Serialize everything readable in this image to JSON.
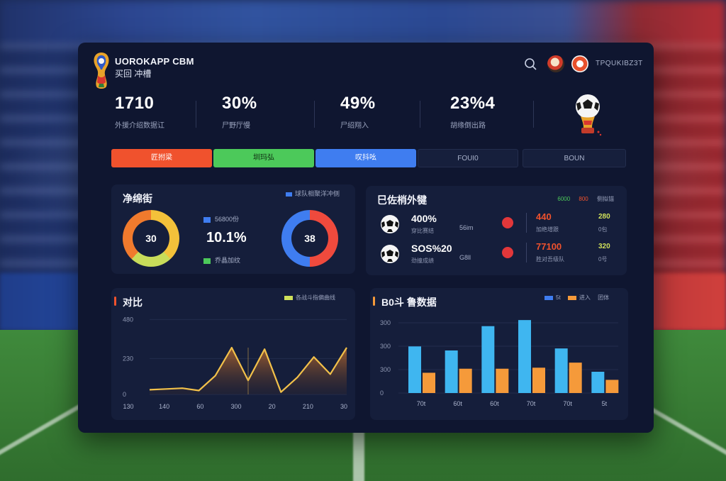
{
  "brand": {
    "title": "UOROKAPP CBM",
    "subtitle": "买回 冲槽",
    "user_label": "TPQUKIBZ3T"
  },
  "header_icons": [
    "search-icon",
    "player-avatar",
    "ball-avatar"
  ],
  "stats": [
    {
      "value": "1710",
      "label": "外援介绍数据讧"
    },
    {
      "value": "30%",
      "label": "尸野厅慢"
    },
    {
      "value": "49%",
      "label": "尸绍翔入"
    },
    {
      "value": "23%4",
      "label": "胡缘倒出路"
    }
  ],
  "tabs": [
    "匠拊梁",
    "圳玛弘",
    "叹抖吆",
    "FOUI0",
    "BOUN"
  ],
  "donut_panel": {
    "title": "净绵街",
    "legend": "球队相聚洋冲侧",
    "key_blue": "56800份",
    "key_green": "乔晶加纹",
    "center_value": "10.1%",
    "donut_left": "30",
    "donut_right": "38"
  },
  "list_panel": {
    "title": "巳佐梢外犍",
    "legend": [
      "6000",
      "800",
      "侧拟锚"
    ],
    "rows": [
      {
        "value": "400%",
        "sublabel": "穿比赛结",
        "stat": "56im",
        "odds": "440",
        "odds_label": "加绝增跟",
        "side": "280",
        "side_label": "0包"
      },
      {
        "value": "SOS%20",
        "sublabel": "劲撞成绩",
        "stat": "G8ll",
        "odds": "77100",
        "odds_label": "胜对吾级队",
        "side": "320",
        "side_label": "0号"
      }
    ]
  },
  "line_panel": {
    "title": "对比",
    "legend": "各战斗指偏曲线"
  },
  "bar_panel": {
    "title": "B0斗 鲁数据",
    "legend": [
      "5t",
      "进入",
      "团体"
    ]
  },
  "colors": {
    "accent_orange": "#f0522d",
    "accent_green": "#4cc95a",
    "accent_blue": "#3f7df0",
    "panel_bg": "#151e3b",
    "window_bg": "#0f1630",
    "bar_cyan": "#3fb6f0",
    "bar_orange": "#f59a3a",
    "line_gold": "#f2c14a"
  },
  "chart_data": [
    {
      "type": "area",
      "title": "对比",
      "x": [
        "130",
        "140",
        "60",
        "300",
        "20",
        "210",
        "30"
      ],
      "x_ticks": [
        "130",
        "140",
        "60",
        "300",
        "20",
        "210",
        "30"
      ],
      "y_ticks": [
        "0",
        "230",
        "480"
      ],
      "ylim": [
        0,
        500
      ],
      "series": [
        {
          "name": "各战斗指偏曲线",
          "values": [
            30,
            35,
            40,
            25,
            120,
            300,
            90,
            290,
            15,
            110,
            240,
            130,
            300
          ]
        }
      ],
      "grid": true
    },
    {
      "type": "bar",
      "title": "B0斗 鲁数据",
      "categories": [
        "70t",
        "60t",
        "60t",
        "70t",
        "70t",
        "5t"
      ],
      "y_ticks": [
        "0",
        "300",
        "300",
        "300"
      ],
      "ylim": [
        0,
        350
      ],
      "series": [
        {
          "name": "进入",
          "values": [
            230,
            210,
            330,
            360,
            220,
            105
          ]
        },
        {
          "name": "团体",
          "values": [
            100,
            120,
            120,
            125,
            150,
            65
          ]
        }
      ],
      "legend": "top-right",
      "grid": true
    }
  ]
}
